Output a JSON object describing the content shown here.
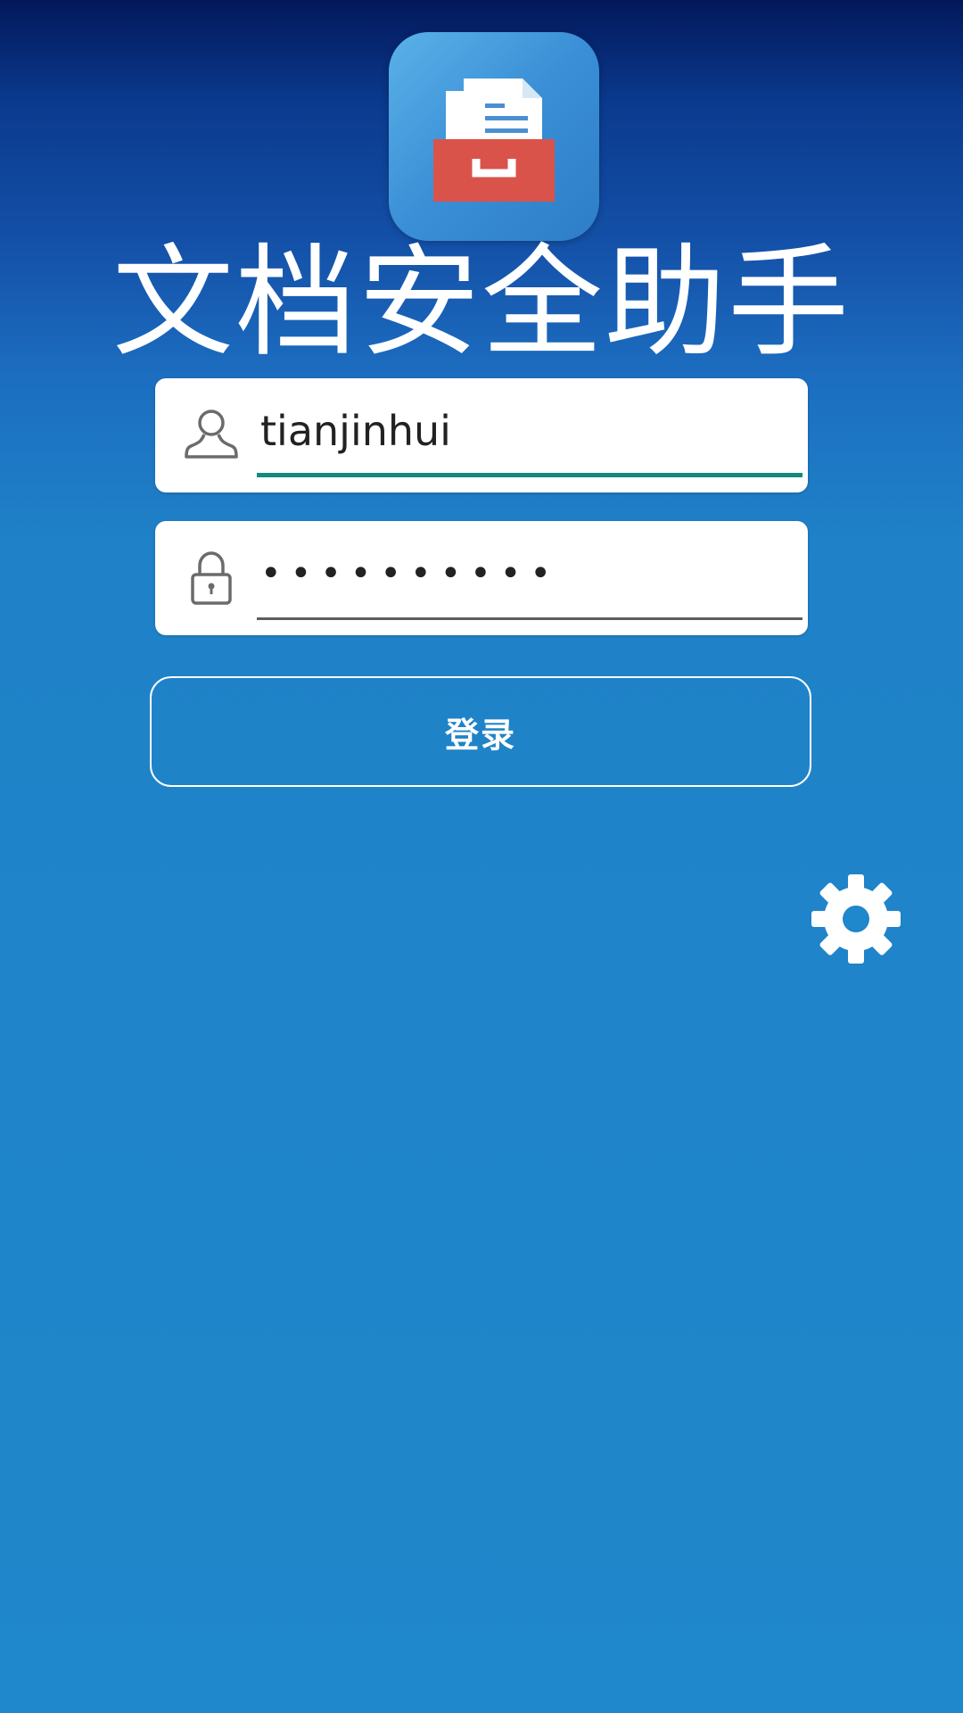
{
  "app": {
    "icon": "document-drawer-icon",
    "title": "文档安全助手"
  },
  "login_form": {
    "username": {
      "icon": "user-icon",
      "value": "tianjinhui"
    },
    "password": {
      "icon": "lock-icon",
      "value": "••••••••••"
    },
    "submit_label": "登录",
    "settings_icon": "gear-icon"
  },
  "colors": {
    "background": "#1f87cb",
    "focus_underline": "#138a7d",
    "icon_red": "#d9534a"
  }
}
